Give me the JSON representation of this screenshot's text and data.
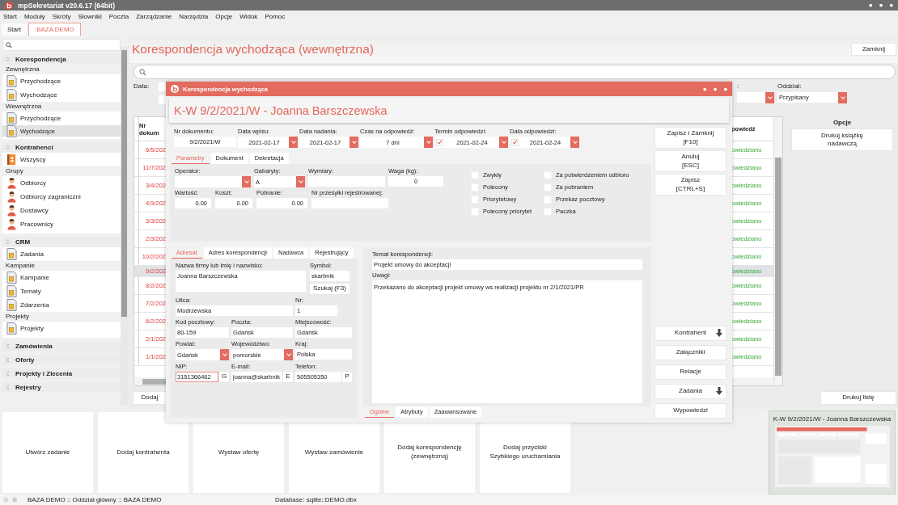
{
  "window": {
    "title": "mpSekretariat v20.6.17 (64bit)"
  },
  "menu": [
    "Start",
    "Moduły",
    "Skróty",
    "Słowniki",
    "Poczta",
    "Zarządzanie",
    "Narzędzia",
    "Opcje",
    "Widok",
    "Pomoc"
  ],
  "tabs": [
    {
      "label": "Start",
      "selected": false
    },
    {
      "label": ":BAZA DEMO",
      "selected": true
    }
  ],
  "sidebar": {
    "sections": [
      {
        "title": "Korespondencja",
        "expanded": true,
        "groups": [
          {
            "label": "Zewnętrzna",
            "items": [
              {
                "label": "Przychodzące",
                "kind": "document",
                "selected": false
              },
              {
                "label": "Wychodzące",
                "kind": "document",
                "selected": false
              }
            ]
          },
          {
            "label": "Wewnętrzna",
            "items": [
              {
                "label": "Przychodzące",
                "kind": "document",
                "selected": false
              },
              {
                "label": "Wychodzące",
                "kind": "document",
                "selected": true
              }
            ]
          }
        ]
      },
      {
        "title": "Kontrahenci",
        "expanded": true,
        "groups": [
          {
            "items": [
              {
                "label": "Wszyscy",
                "kind": "book",
                "selected": false
              }
            ]
          },
          {
            "label": "Grupy",
            "items": [
              {
                "label": "Odbiorcy",
                "kind": "person",
                "selected": false
              },
              {
                "label": "Odbiorcy zagraniczni",
                "kind": "person",
                "selected": false
              },
              {
                "label": "Dostawcy",
                "kind": "person",
                "selected": false
              },
              {
                "label": "Pracownicy",
                "kind": "person",
                "selected": false
              }
            ]
          }
        ]
      },
      {
        "title": "CRM",
        "expanded": true,
        "groups": [
          {
            "items": [
              {
                "label": "Zadania",
                "kind": "document",
                "selected": false
              }
            ]
          },
          {
            "label": "Kampanie",
            "items": [
              {
                "label": "Kampanie",
                "kind": "document",
                "selected": false
              },
              {
                "label": "Tematy",
                "kind": "document",
                "selected": false
              },
              {
                "label": "Zdarzenia",
                "kind": "document",
                "selected": false
              }
            ]
          },
          {
            "label": "Projekty",
            "items": [
              {
                "label": "Projekty",
                "kind": "document",
                "selected": false
              }
            ]
          }
        ]
      },
      {
        "title": "Zamówienia",
        "expanded": false
      },
      {
        "title": "Oferty",
        "expanded": false
      },
      {
        "title": "Projekty i Zlecenia",
        "expanded": false
      },
      {
        "title": "Rejestry",
        "expanded": false
      }
    ]
  },
  "page": {
    "title": "Korespondencja wychodząca (wewnętrzna)",
    "close_button": "Zamknij",
    "filters": [
      {
        "label": "Data:",
        "kind": "range"
      },
      {
        "label": ":",
        "kind": "select"
      },
      {
        "label": "Oddział:",
        "kind": "select",
        "value": "Przypisany"
      }
    ],
    "table": {
      "columns": [
        "Nr dokum",
        "powiedź"
      ],
      "rows": [
        {
          "cells": [
            "6/5/202",
            "owiedziano"
          ],
          "selected": false
        },
        {
          "cells": [
            "11/7/202",
            "owiedziano"
          ],
          "selected": false
        },
        {
          "cells": [
            "3/4/202",
            "owiedziano"
          ],
          "selected": false
        },
        {
          "cells": [
            "4/3/202",
            "owiedziano"
          ],
          "selected": false
        },
        {
          "cells": [
            "3/3/202",
            "owiedziano"
          ],
          "selected": false
        },
        {
          "cells": [
            "2/3/202",
            "owiedziano"
          ],
          "selected": false
        },
        {
          "cells": [
            "10/2/202",
            "owiedziano"
          ],
          "selected": false
        },
        {
          "cells": [
            "9/2/202",
            "owiedziano"
          ],
          "selected": true
        },
        {
          "cells": [
            "8/2/202",
            "owiedziano"
          ],
          "selected": false
        },
        {
          "cells": [
            "7/2/202",
            "owiedziano"
          ],
          "selected": false
        },
        {
          "cells": [
            "6/2/202",
            "owiedziano"
          ],
          "selected": false
        },
        {
          "cells": [
            "2/1/202",
            "owiedziano"
          ],
          "selected": false
        },
        {
          "cells": [
            "1/1/202",
            "owiedziano"
          ],
          "selected": false
        }
      ]
    },
    "add_button": "Dodaj",
    "print_button": "Drukuj listę",
    "options": {
      "title": "Opcje",
      "buttons": [
        "Drukuj książkę\nnadawczą"
      ]
    }
  },
  "dialog": {
    "title": "Korespondencja wychodząca",
    "heading": "K-W 9/2/2021/W - Joanna Barszczewska",
    "top_fields": [
      {
        "label": "Nr dokumentu:",
        "value": "9/2/2021/W",
        "kind": "text"
      },
      {
        "label": "Data wpisu:",
        "value": "2021-02-17",
        "kind": "select"
      },
      {
        "label": "Data nadania:",
        "value": "2021-02-17",
        "kind": "select"
      },
      {
        "label": "Czas na odpowiedź:",
        "value": "7 dni",
        "kind": "select"
      },
      {
        "label": "Termin odpowiedzi:",
        "value": "2021-02-24",
        "kind": "check-select",
        "checked": true
      },
      {
        "label": "Data odpowiedzi:",
        "value": "2021-02-24",
        "kind": "check-select",
        "checked": true
      }
    ],
    "param_tabs": [
      {
        "label": "Parametry",
        "selected": true
      },
      {
        "label": "Dokument",
        "selected": false
      },
      {
        "label": "Dekretacja",
        "selected": false
      }
    ],
    "params": [
      [
        {
          "label": "Operator:",
          "kind": "select"
        },
        {
          "label": "Gabaryty:",
          "value": "A",
          "kind": "select"
        },
        {
          "label": "Wymiary:",
          "kind": "text"
        },
        {
          "label": "Waga (kg):",
          "value": "0",
          "kind": "number"
        }
      ],
      [
        {
          "label": "Wartość:",
          "value": "0.00",
          "kind": "number"
        },
        {
          "label": "Koszt:",
          "value": "0.00",
          "kind": "number"
        },
        {
          "label": "Pobranie:",
          "value": "0.00",
          "kind": "number"
        },
        {
          "label": "Nr przesyłki rejestrowanej:",
          "kind": "text"
        }
      ]
    ],
    "shipping_options": [
      {
        "label": "Zwykły",
        "checked": false
      },
      {
        "label": "Polecony",
        "checked": false
      },
      {
        "label": "Priorytetowy",
        "checked": false
      },
      {
        "label": "Polecony priorytet",
        "checked": false
      },
      {
        "label": "Za potwierdzeniem odbioru",
        "checked": false
      },
      {
        "label": "Za pobraniem",
        "checked": false
      },
      {
        "label": "Przekaz pocztowy",
        "checked": false
      },
      {
        "label": "Paczka",
        "checked": false
      }
    ],
    "address_tabs": [
      {
        "label": "Adresat",
        "selected": true
      },
      {
        "label": "Adres korespondencji",
        "selected": false
      },
      {
        "label": "Nadawca",
        "selected": false
      },
      {
        "label": "Rejestrujący",
        "selected": false
      }
    ],
    "address": {
      "name": {
        "label": "Nazwa firmy lub imię i nazwisko:",
        "value": "Joanna Barszczewska"
      },
      "symbol": {
        "label": "Symbol:",
        "value": "skarbnik"
      },
      "search_button": "Szukaj (F3)",
      "street": {
        "label": "Ulica:",
        "value": "Modrzewska"
      },
      "number": {
        "label": "Nr:",
        "value": "1"
      },
      "rows": [
        [
          {
            "label": "Kod pocztowy:",
            "value": "80-159",
            "kind": "text"
          },
          {
            "label": "Poczta:",
            "value": "Gdańsk",
            "kind": "text"
          },
          {
            "label": "Miejscowość:",
            "value": "Gdańsk",
            "kind": "text"
          }
        ],
        [
          {
            "label": "Powiat:",
            "value": "Gdańsk",
            "kind": "select"
          },
          {
            "label": "Województwo:",
            "value": "pomorskie",
            "kind": "select"
          },
          {
            "label": "Kraj:",
            "value": "Polska",
            "kind": "text"
          }
        ],
        [
          {
            "label": "NIP:",
            "value": "3151366462",
            "kind": "text-button",
            "button": "G",
            "focused": true
          },
          {
            "label": "E-mail:",
            "value": "joanna@skarbnik",
            "kind": "text-button",
            "button": "E",
            "focused": false
          },
          {
            "label": "Telefon:",
            "value": "505505350",
            "kind": "text-button",
            "button": "P",
            "focused": false
          }
        ]
      ]
    },
    "subject": {
      "label": "Temat korespondencji:",
      "value": "Projekt umowy do akceptacji"
    },
    "notes": {
      "label": "Uwagi:",
      "value": "Przekazano do akceptacji projekt umowy ws realizacji projektu nr 2/1/2021/PR"
    },
    "bottom_tabs": [
      {
        "label": "Ogólne",
        "selected": true
      },
      {
        "label": "Atrybuty",
        "selected": false
      },
      {
        "label": "Zaawansowane",
        "selected": false
      }
    ],
    "main_actions": [
      "Zapisz i Zamknij\n[F10]",
      "Anuluj\n[ESC]",
      "Zapisz\n[CTRL+S]"
    ],
    "actions": [
      {
        "label": "Kontrahent",
        "dropdown": true
      },
      {
        "label": "Załączniki",
        "dropdown": false
      },
      {
        "label": "Relacje",
        "dropdown": false
      },
      {
        "label": "Zadania",
        "dropdown": true
      },
      {
        "label": "Wypowiedzi",
        "dropdown": false
      }
    ]
  },
  "quick_tiles": [
    "Utwórz zadanie",
    "Dodaj kontrahenta",
    "Wystaw ofertę",
    "Wystaw zamówienie",
    "Dodaj korespondencję\n(zewnętrzną)",
    "Dodaj przyciski\nSzybkiego uruchamiania"
  ],
  "preview": {
    "title": "K-W 9/2/2021/W - Joanna Barszczewska"
  },
  "status_bar": {
    "text": "BAZA DEMO :: Oddział główny :: BAZA DEMO",
    "database": "Database: sqlite::DEMO.dbx"
  }
}
